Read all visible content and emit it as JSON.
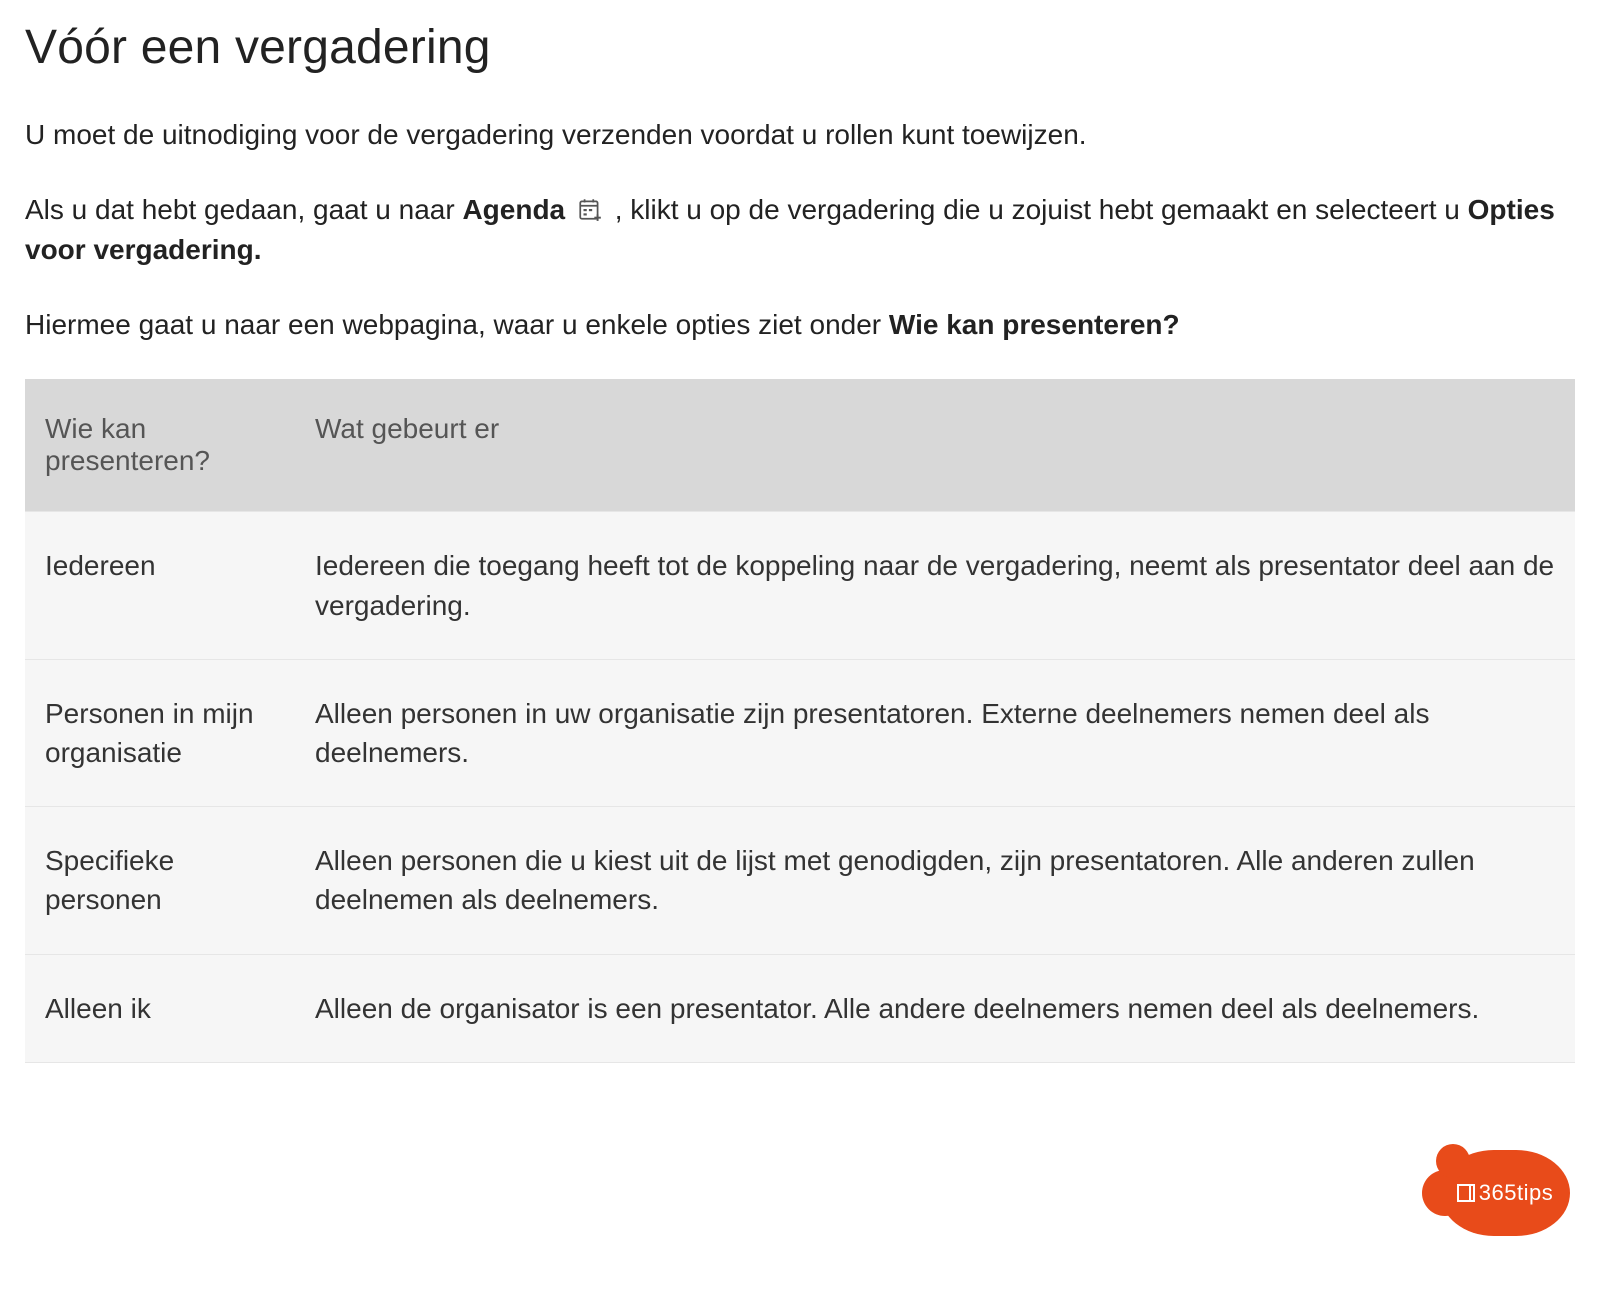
{
  "title": "Vóór een vergadering",
  "para1": "U moet de uitnodiging voor de vergadering verzenden voordat u rollen kunt toewijzen.",
  "para2": {
    "pre": "Als u dat hebt gedaan, gaat u naar ",
    "b1": "Agenda",
    "mid": " , klikt u op de vergadering die u zojuist hebt gemaakt en selecteert u ",
    "b2": "Opties voor vergadering."
  },
  "para3": {
    "pre": "Hiermee gaat u naar een webpagina, waar u enkele opties ziet onder ",
    "b1": "Wie kan presenteren?"
  },
  "table": {
    "head": {
      "col1": "Wie kan presenteren?",
      "col2": "Wat gebeurt er"
    },
    "rows": [
      {
        "who": "Iedereen",
        "what": "Iedereen die toegang heeft tot de koppeling naar de vergadering, neemt als presentator deel aan de vergadering."
      },
      {
        "who": "Personen in mijn organisatie",
        "what": "Alleen personen in uw organisatie zijn presentatoren. Externe deelnemers nemen deel als deelnemers."
      },
      {
        "who": "Specifieke personen",
        "what": "Alleen personen die u kiest uit de lijst met genodigden, zijn presentatoren. Alle anderen zullen deelnemen als deelnemers."
      },
      {
        "who": "Alleen ik",
        "what": "Alleen de organisator is een presentator. Alle andere deelnemers nemen deel als deelnemers."
      }
    ]
  },
  "badge": {
    "label": "365tips"
  }
}
